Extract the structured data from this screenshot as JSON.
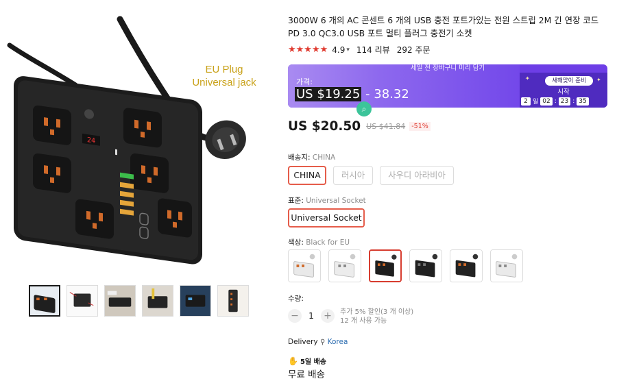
{
  "gallery": {
    "main_alt_caption_line1": "EU Plug",
    "main_alt_caption_line2": "Universal jack",
    "display_reading": "24",
    "thumbnail_count": 6
  },
  "product": {
    "title": "3000W 6 개의 AC 콘센트 6 개의 USB 충전 포트가있는 전원 스트립 2M 긴 연장 코드 PD 3.0 QC3.0 USB 포트 멀티 플러그 충전기 소켓",
    "stars": "★★★★★",
    "rating": "4.9",
    "reviews": "114 리뷰",
    "orders": "292 주문"
  },
  "promo": {
    "banner_top": "세일 전 장바구니 미리 담기",
    "price_label": "가격:",
    "price_low": "US $19.25",
    "price_high": " - 38.32",
    "coming_label": "새해맞이 준비",
    "start_label": "시작",
    "countdown": {
      "days": "2",
      "day_unit": "일",
      "hours": "02",
      "minutes": "23",
      "seconds": "35"
    }
  },
  "price": {
    "current": "US $20.50",
    "original": "US $41.84",
    "discount": "-51%"
  },
  "ship_from": {
    "label": "배송지: ",
    "selected": "CHINA",
    "options": [
      "CHINA",
      "러시아",
      "사우디 아라비아"
    ]
  },
  "standard": {
    "label": "표준: ",
    "selected": "Universal Socket",
    "options": [
      "Universal Socket"
    ]
  },
  "color": {
    "label": "색상: ",
    "selected": "Black for EU",
    "swatch_count": 6,
    "selected_index": 2
  },
  "quantity": {
    "label": "수량:",
    "value": "1",
    "minus": "−",
    "plus": "+",
    "note_line1": "추가 5% 할인(3 개 이상)",
    "note_line2": "12 개 사용 가능"
  },
  "delivery": {
    "label": "Delivery",
    "location": "Korea",
    "speed_badge": "5일 배송",
    "free_shipping": "무료 배송"
  }
}
